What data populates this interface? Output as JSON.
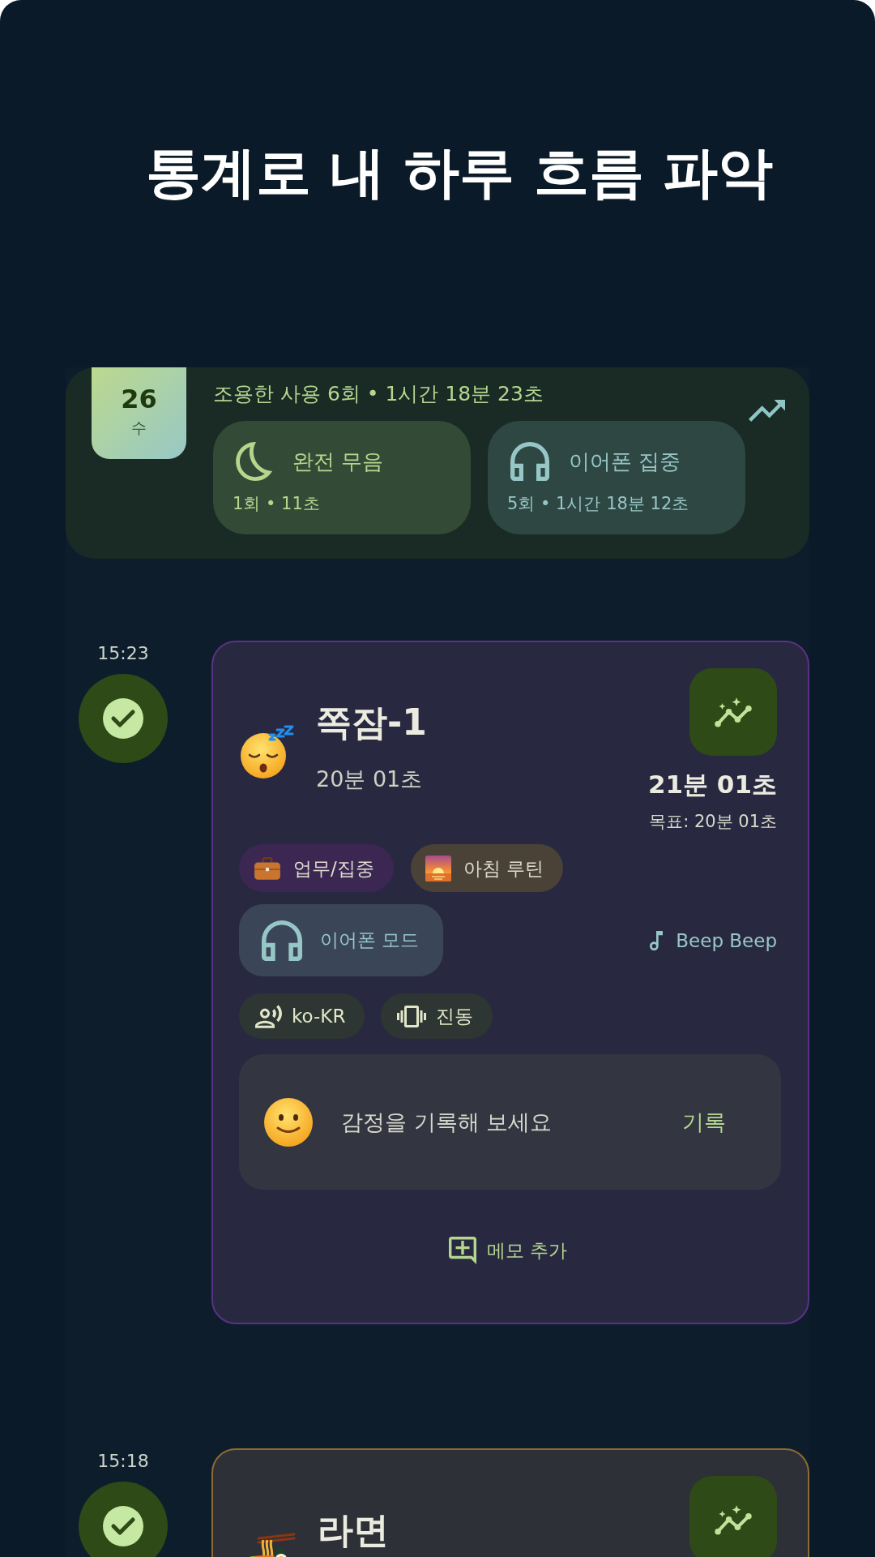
{
  "headline": "통계로 내 하루 흐름 파악",
  "day_summary": {
    "date": "26",
    "weekday": "수",
    "summary": "조용한 사용 6회 • 1시간 18분 23초",
    "modes": [
      {
        "kind": "silent",
        "name": "완전 무음",
        "stats": "1회 • 11초"
      },
      {
        "kind": "earphone",
        "name": "이어폰 집중",
        "stats": "5회 • 1시간 18분 12초"
      }
    ]
  },
  "entries": [
    {
      "time": "15:23",
      "completed": true,
      "color": "#5b3283",
      "kind": "sleep",
      "title": "쪽잠-1",
      "planned": "20분 01초",
      "actual": "21분 01초",
      "goal": "목표: 20분 01초",
      "tags": [
        {
          "kind": "work",
          "label": "업무/집중",
          "color": "#3b2752"
        },
        {
          "kind": "morning",
          "label": "아침 루틴",
          "color": "#4b4237"
        }
      ],
      "mode": {
        "kind": "earphone",
        "label": "이어폰 모드"
      },
      "sound": "Beep Beep",
      "settings": [
        {
          "kind": "voice",
          "label": "ko-KR"
        },
        {
          "kind": "vibration",
          "label": "진동"
        }
      ],
      "mood": {
        "prompt": "감정을 기록해 보세요",
        "action": "기록"
      },
      "memo_action": "메모 추가"
    },
    {
      "time": "15:18",
      "completed": true,
      "color": "#8d6c32",
      "kind": "meal",
      "title": "라면"
    }
  ]
}
